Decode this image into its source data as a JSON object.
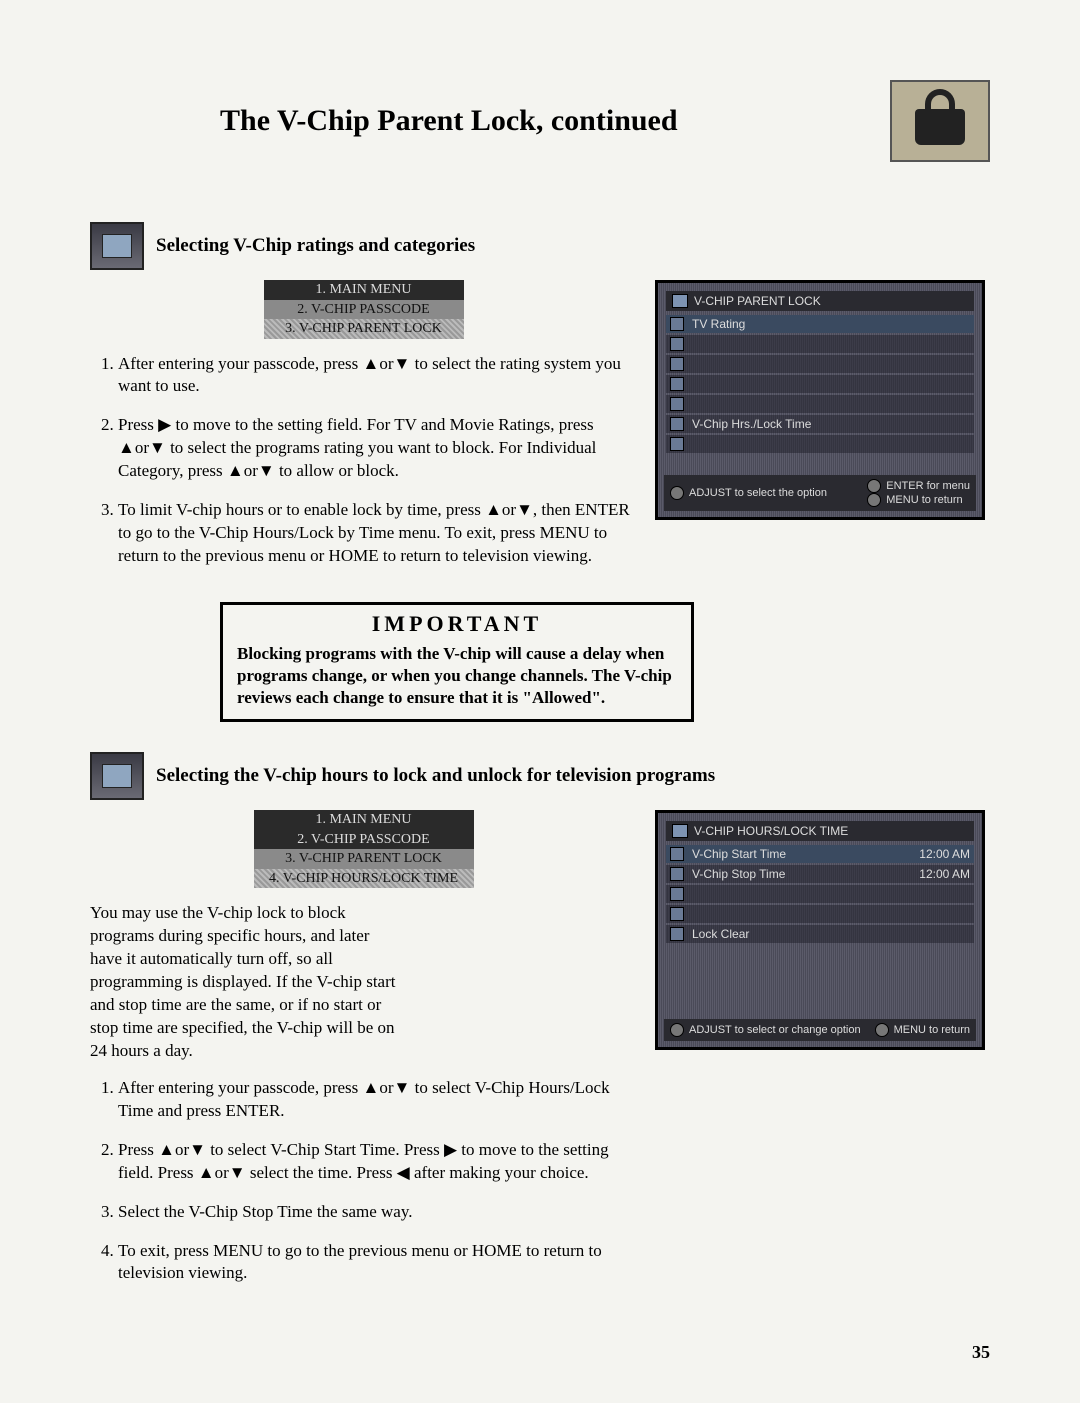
{
  "page_title": "The V-Chip Parent Lock, continued",
  "page_number": "35",
  "lock_icon_name": "lock-icon",
  "section1": {
    "title": "Selecting V-Chip ratings and categories",
    "breadcrumb": [
      "1. MAIN MENU",
      "2. V-CHIP PASSCODE",
      "3. V-CHIP PARENT LOCK"
    ],
    "steps": [
      "After entering your passcode, press ▲or▼ to select the rating system you want to use.",
      "Press ▶ to move to the setting field. For TV and Movie Ratings, press ▲or▼ to select the programs rating you want to block. For Individual Category, press ▲or▼ to allow or block.",
      "To limit V-chip hours or to enable lock by time, press ▲or▼, then ENTER to go to the V-Chip Hours/Lock by Time menu. To exit, press MENU to return to the previous menu or HOME to return to television viewing."
    ],
    "osd": {
      "title": "V-CHIP PARENT LOCK",
      "rows": [
        "TV Rating",
        "",
        "",
        "",
        "",
        "V-Chip Hrs./Lock Time",
        ""
      ],
      "footer_left": "ADJUST to select the option",
      "footer_right_1": "ENTER for menu",
      "footer_right_2": "MENU to return"
    }
  },
  "important": {
    "title": "IMPORTANT",
    "body": "Blocking programs with the V-chip will cause a delay when programs change, or when you change channels. The V-chip reviews each change to ensure that it is \"Allowed\"."
  },
  "section2": {
    "title": "Selecting the V-chip hours to lock and unlock for television programs",
    "breadcrumb": [
      "1. MAIN MENU",
      "2. V-CHIP PASSCODE",
      "3. V-CHIP PARENT LOCK",
      "4. V-CHIP HOURS/LOCK TIME"
    ],
    "intro": "You may use the V-chip lock to block programs during specific hours, and later have it automatically turn off, so all programming is displayed. If the V-chip start and stop time are the same, or if no start or stop time are specified, the V-chip will be on 24 hours a day.",
    "steps": [
      "After entering your passcode, press ▲or▼ to select V-Chip Hours/Lock Time and press ENTER.",
      "Press ▲or▼ to select V-Chip Start Time. Press ▶ to move to the setting field. Press ▲or▼ select the time. Press ◀ after making your choice.",
      "Select the V-Chip Stop Time the same way.",
      "To exit, press MENU to go to the previous menu or HOME to return to television viewing."
    ],
    "osd": {
      "title": "V-CHIP HOURS/LOCK TIME",
      "rows": [
        {
          "label": "V-Chip Start Time",
          "value": "12:00 AM"
        },
        {
          "label": "V-Chip Stop Time",
          "value": "12:00 AM"
        },
        {
          "label": "",
          "value": ""
        },
        {
          "label": "",
          "value": ""
        },
        {
          "label": "Lock Clear",
          "value": ""
        }
      ],
      "footer_left": "ADJUST to select or change option",
      "footer_right": "MENU to return"
    }
  }
}
